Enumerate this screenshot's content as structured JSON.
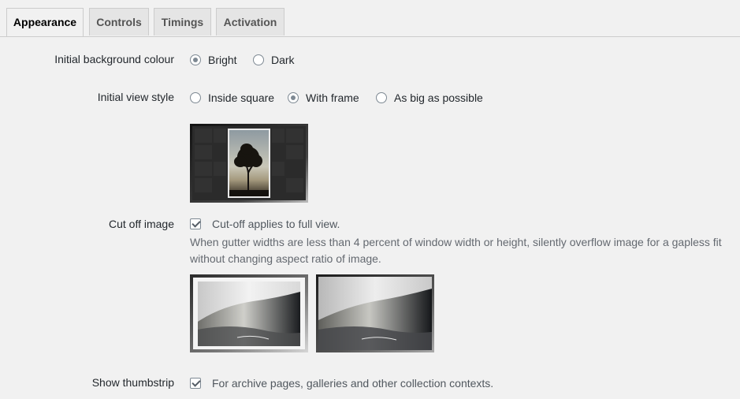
{
  "tabs": [
    {
      "label": "Appearance",
      "active": true
    },
    {
      "label": "Controls",
      "active": false
    },
    {
      "label": "Timings",
      "active": false
    },
    {
      "label": "Activation",
      "active": false
    }
  ],
  "background": {
    "label": "Initial background colour",
    "options": [
      {
        "label": "Bright",
        "checked": true
      },
      {
        "label": "Dark",
        "checked": false
      }
    ]
  },
  "view_style": {
    "label": "Initial view style",
    "options": [
      {
        "label": "Inside square",
        "checked": false
      },
      {
        "label": "With frame",
        "checked": true
      },
      {
        "label": "As big as possible",
        "checked": false
      }
    ]
  },
  "cut_off": {
    "label": "Cut off image",
    "checkbox_label": "Cut-off applies to full view.",
    "checked": true,
    "description_line1": "When gutter widths are less than 4 percent of window width or height, silently overflow image for a gapless fit",
    "description_line2": "without changing aspect ratio of image."
  },
  "thumbstrip": {
    "label": "Show thumbstrip",
    "checkbox_label": "For archive pages, galleries and other collection contexts.",
    "checked": true
  }
}
